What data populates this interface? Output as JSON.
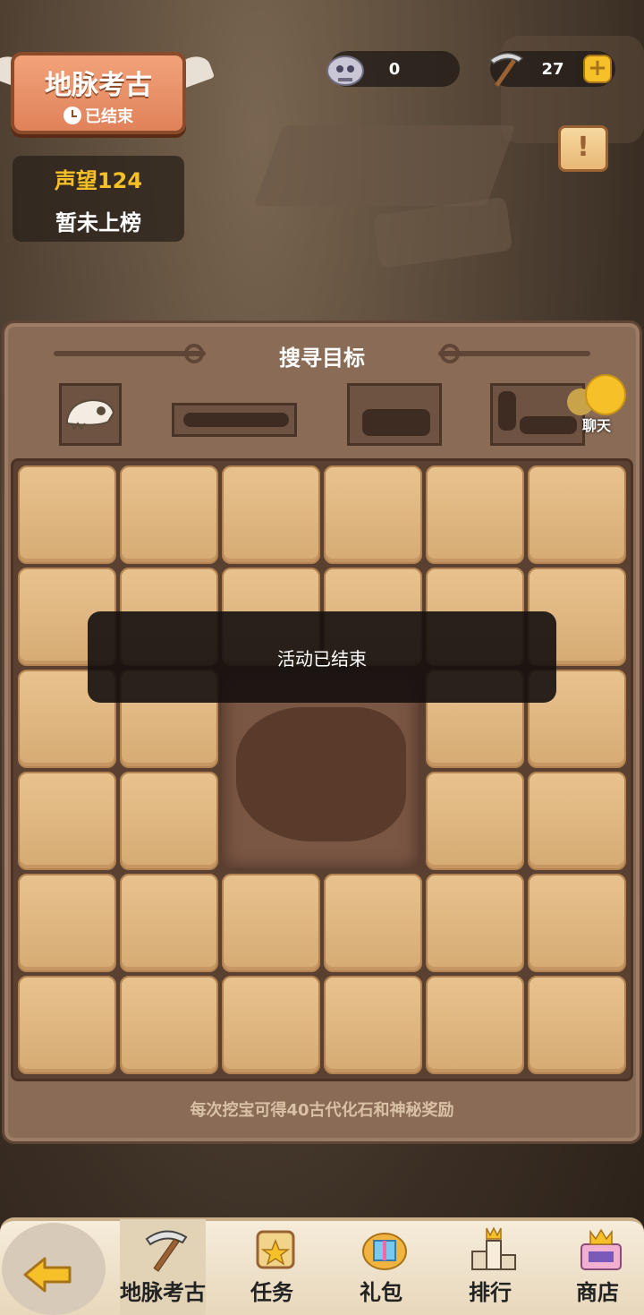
{
  "header": {
    "title": "地脉考古",
    "status": "已结束",
    "fossil_count": "0",
    "pickaxe_count": "27",
    "plus_symbol": "+",
    "info_symbol": "!"
  },
  "reputation": {
    "label": "声望124",
    "rank": "暂未上榜"
  },
  "panel": {
    "title": "搜寻目标",
    "chat_label": "聊天",
    "hint": "每次挖宝可得40古代化石和神秘奖励"
  },
  "grid": {
    "rows": 6,
    "cols": 6,
    "dug_block": "rows 3-4, cols 3-4"
  },
  "toast": {
    "message": "活动已结束"
  },
  "bottom_nav": {
    "items": [
      {
        "label": "地脉考古",
        "icon": "pickaxe-icon",
        "active": true
      },
      {
        "label": "任务",
        "icon": "task-scroll-icon",
        "active": false
      },
      {
        "label": "礼包",
        "icon": "gift-icon",
        "active": false
      },
      {
        "label": "排行",
        "icon": "podium-icon",
        "active": false
      },
      {
        "label": "商店",
        "icon": "shop-icon",
        "active": false
      }
    ]
  },
  "colors": {
    "accent_gold": "#f6c028",
    "banner_orange": "#e0825a",
    "tile": "#d6ab74",
    "panel": "#8a6b55"
  }
}
